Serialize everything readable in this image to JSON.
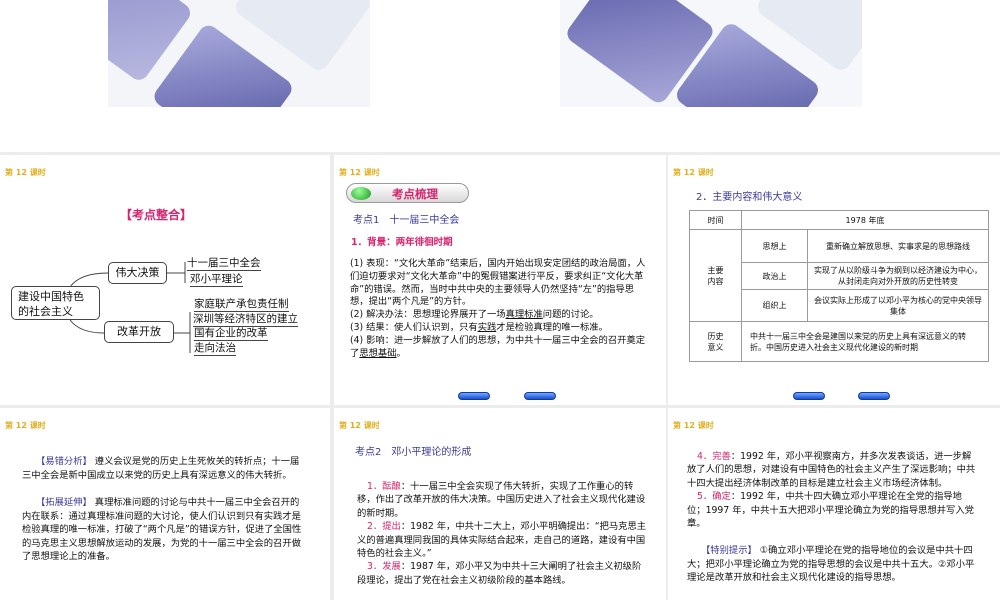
{
  "lesson_label": "第 12 课时",
  "slide1": {
    "title": "【考点整合】",
    "root": "建设中国特色的社会主义",
    "branches": [
      {
        "label": "伟大决策",
        "leaves": [
          "十一届三中全会",
          "邓小平理论"
        ]
      },
      {
        "label": "改革开放",
        "leaves": [
          "家庭联产承包责任制",
          "深圳等经济特区的建立",
          "国有企业的改革",
          "走向法治"
        ]
      }
    ]
  },
  "slide2": {
    "banner": "考点梳理",
    "heading": "考点1　十一届三中全会",
    "sub": "1．背景：两年徘徊时期",
    "p1": "(1) 表现：“文化大革命”结束后，国内开始出现安定团结的政治局面，人们迫切要求对“文化大革命”中的冤假错案进行平反，要求纠正“文化大革命”的错误。然而，当时中共中央的主要领导人仍然坚持“左”的指导思想，提出“两个凡是”的方针。",
    "p2a": "(2) 解决办法：思想理论界展开了一场",
    "p2u": "真理标准",
    "p2b": "问题的讨论。",
    "p3a": "(3) 结果：使人们认识到，只有",
    "p3u": "实践",
    "p3b": "才是检验真理的唯一标准。",
    "p4a": "(4) 影响：进一步解放了人们的思想，为中共十一届三中全会的召开奠定了",
    "p4u": "思想基础",
    "p4b": "。"
  },
  "slide3": {
    "heading": "2．主要内容和伟大意义",
    "table": {
      "time_label": "时间",
      "time_value": "1978 年底",
      "content_label": "主要内容",
      "rows": [
        {
          "k": "思想上",
          "v": "重新确立解放思想、实事求是的思想路线"
        },
        {
          "k": "政治上",
          "v": "实现了从以阶级斗争为纲到以经济建设为中心，从封闭走向对外开放的历史性转变"
        },
        {
          "k": "组织上",
          "v": "会议实际上形成了以邓小平为核心的党中央领导集体"
        }
      ],
      "sig_label": "历史意义",
      "sig_value": "中共十一届三中全会是建国以来党的历史上具有深远意义的转折。中国历史进入社会主义现代化建设的新时期"
    }
  },
  "slide4": {
    "tag1": "【易错分析】",
    "t1": "遵义会议是党的历史上生死攸关的转折点；十一届三中全会是新中国成立以来党的历史上具有深远意义的伟大转折。",
    "tag2": "【拓展延伸】",
    "t2": "真理标准问题的讨论与中共十一届三中全会召开的内在联系：通过真理标准问题的大讨论，使人们认识到只有实践才是检验真理的唯一标准，打破了“两个凡是”的错误方针，促进了全国性的马克思主义思想解放运动的发展，为党的十一届三中全会的召开做了思想理论上的准备。"
  },
  "slide5": {
    "heading": "考点2　邓小平理论的形成",
    "items": [
      {
        "k": "1．酝酿",
        "t": "：十一届三中全会实现了伟大转折，实现了工作重心的转移，作出了改革开放的伟大决策。中国历史进入了社会主义现代化建设的新时期。"
      },
      {
        "k": "2．提出",
        "t": "：1982 年，中共十二大上，邓小平明确提出：“把马克思主义的普遍真理同我国的具体实际结合起来，走自己的道路，建设有中国特色的社会主义。”"
      },
      {
        "k": "3．发展",
        "t": "：1987 年，邓小平又为中共十三大阐明了社会主义初级阶段理论，提出了党在社会主义初级阶段的基本路线。"
      }
    ]
  },
  "slide6": {
    "items": [
      {
        "k": "4．完善",
        "t": "：1992 年，邓小平视察南方，并多次发表谈话，进一步解放了人们的思想，对建设有中国特色的社会主义产生了深远影响；中共十四大提出经济体制改革的目标是建立社会主义市场经济体制。"
      },
      {
        "k": "5．确定",
        "t": "：1992 年，中共十四大确立邓小平理论在全党的指导地位；1997 年，中共十五大把邓小平理论确立为党的指导思想并写入党章。"
      }
    ],
    "tag": "【特别提示】",
    "tip": "①确立邓小平理论在党的指导地位的会议是中共十四大；把邓小平理论确立为党的指导思想的会议是中共十五大。②邓小平理论是改革开放和社会主义现代化建设的指导思想。"
  }
}
